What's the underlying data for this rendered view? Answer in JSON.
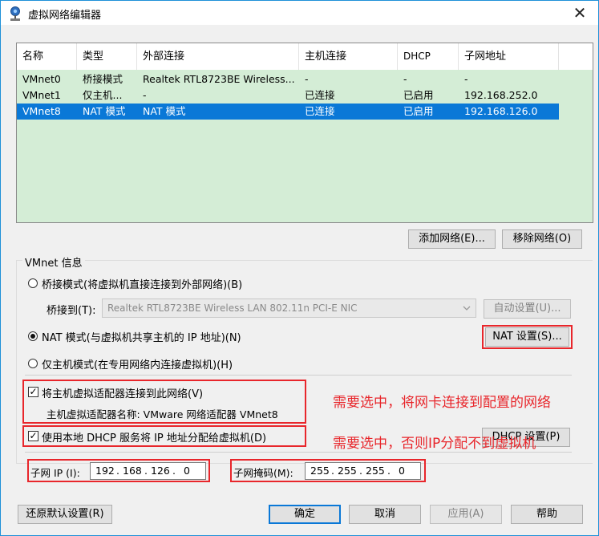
{
  "window": {
    "title": "虚拟网络编辑器",
    "close_glyph": "✕"
  },
  "table": {
    "columns": [
      "名称",
      "类型",
      "外部连接",
      "主机连接",
      "DHCP",
      "子网地址"
    ],
    "rows": [
      {
        "name": "VMnet0",
        "type": "桥接模式",
        "external": "Realtek RTL8723BE Wireless...",
        "host": "-",
        "dhcp": "-",
        "subnet": "-",
        "selected": false
      },
      {
        "name": "VMnet1",
        "type": "仅主机...",
        "external": "-",
        "host": "已连接",
        "dhcp": "已启用",
        "subnet": "192.168.252.0",
        "selected": false
      },
      {
        "name": "VMnet8",
        "type": "NAT 模式",
        "external": "NAT 模式",
        "host": "已连接",
        "dhcp": "已启用",
        "subnet": "192.168.126.0",
        "selected": true
      }
    ]
  },
  "buttons": {
    "add_network": "添加网络(E)...",
    "remove_network": "移除网络(O)",
    "auto_settings": "自动设置(U)...",
    "nat_settings": "NAT 设置(S)...",
    "dhcp_settings": "DHCP 设置(P)",
    "restore_defaults": "还原默认设置(R)",
    "ok": "确定",
    "cancel": "取消",
    "apply": "应用(A)",
    "help": "帮助"
  },
  "info": {
    "group_title": "VMnet 信息",
    "bridge_radio": "桥接模式(将虚拟机直接连接到外部网络)(B)",
    "bridge_to_label": "桥接到(T):",
    "bridge_to_value": "Realtek RTL8723BE Wireless LAN 802.11n PCI-E NIC",
    "nat_radio": "NAT 模式(与虚拟机共享主机的 IP 地址)(N)",
    "hostonly_radio": "仅主机模式(在专用网络内连接虚拟机)(H)",
    "connect_adapter_check": "将主机虚拟适配器连接到此网络(V)",
    "adapter_name_label": "主机虚拟适配器名称: VMware 网络适配器 VMnet8",
    "dhcp_check": "使用本地 DHCP 服务将 IP 地址分配给虚拟机(D)",
    "subnet_ip_label": "子网 IP (I):",
    "subnet_ip": [
      "192",
      "168",
      "126",
      "0"
    ],
    "subnet_mask_label": "子网掩码(M):",
    "subnet_mask": [
      "255",
      "255",
      "255",
      "0"
    ]
  },
  "state": {
    "mode": "nat",
    "connect_adapter": true,
    "dhcp": true
  },
  "annotations": {
    "note1": "需要选中，将网卡连接到配置的网络",
    "note2": "需要选中，否则IP分配不到虚拟机"
  },
  "colors": {
    "selection": "#0a78d7",
    "list_bg": "#d4edd6",
    "annotation": "#e8262b"
  },
  "icons": {
    "app": "vmware-network-icon",
    "close": "close-icon",
    "dropdown": "chevron-down-icon"
  }
}
